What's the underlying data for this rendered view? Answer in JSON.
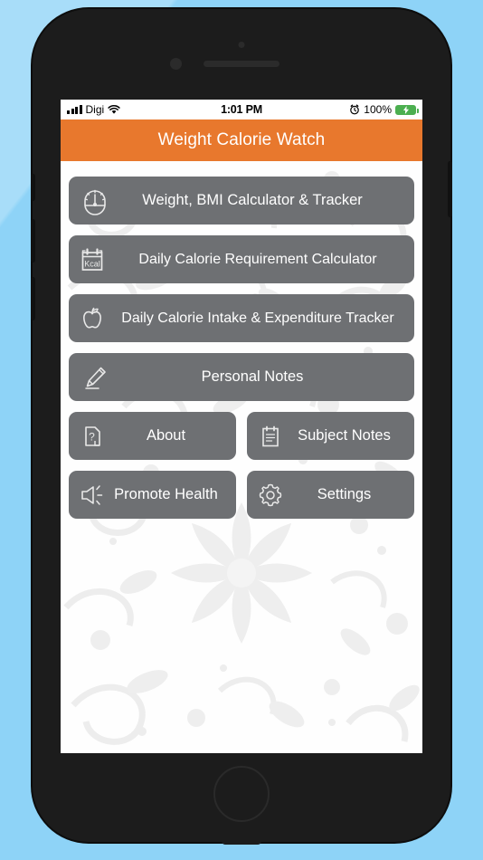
{
  "device": {
    "name": "iphone-mockup",
    "backdrop_color": "#8ed3f7",
    "bezel_color": "#1c1c1c"
  },
  "status_bar": {
    "signal_icon": "signal-bars-icon",
    "carrier": "Digi",
    "wifi_icon": "wifi-icon",
    "time": "1:01 PM",
    "alarm_icon": "alarm-clock-icon",
    "battery_percent": "100%",
    "battery_icon": "battery-charging-icon",
    "battery_color": "#4caf50"
  },
  "nav_bar": {
    "title": "Weight Calorie Watch",
    "background": "#e8782d",
    "text_color": "#ffffff"
  },
  "menu": {
    "button_color": "#6e7073",
    "full_width_items": [
      {
        "id": "weight-bmi-calculator-tracker",
        "label": "Weight, BMI Calculator & Tracker",
        "icon": "speedometer-icon"
      },
      {
        "id": "daily-calorie-requirement-calculator",
        "label": "Daily Calorie Requirement Calculator",
        "icon": "kcal-calendar-icon",
        "icon_text": "Kcal"
      },
      {
        "id": "daily-calorie-intake-expenditure-tracker",
        "label": "Daily Calorie Intake & Expenditure Tracker",
        "icon": "apple-icon"
      },
      {
        "id": "personal-notes",
        "label": "Personal Notes",
        "icon": "pencil-icon"
      }
    ],
    "grid_items": [
      {
        "id": "about",
        "label": "About",
        "icon": "document-question-icon"
      },
      {
        "id": "subject-notes",
        "label": "Subject Notes",
        "icon": "clipboard-icon"
      },
      {
        "id": "promote-health",
        "label": "Promote Health",
        "icon": "speaker-icon"
      },
      {
        "id": "settings",
        "label": "Settings",
        "icon": "gear-icon"
      }
    ]
  }
}
